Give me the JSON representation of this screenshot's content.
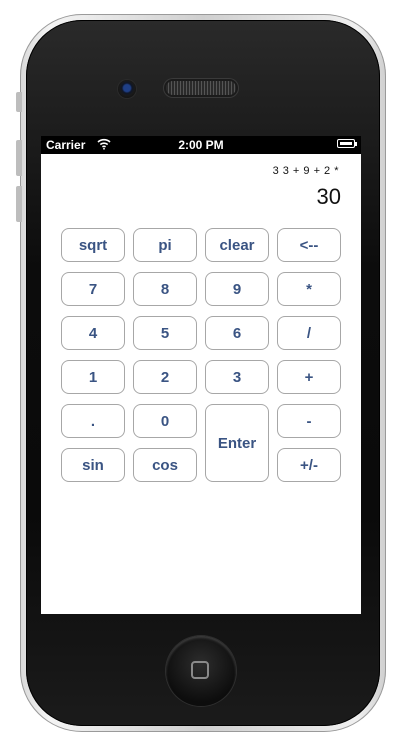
{
  "status_bar": {
    "carrier": "Carrier",
    "time": "2:00 PM"
  },
  "calculator": {
    "history": "3 3 + 9 + 2 *",
    "display": "30",
    "buttons": {
      "sqrt": "sqrt",
      "pi": "pi",
      "clear": "clear",
      "backspace": "<--",
      "seven": "7",
      "eight": "8",
      "nine": "9",
      "multiply": "*",
      "four": "4",
      "five": "5",
      "six": "6",
      "divide": "/",
      "one": "1",
      "two": "2",
      "three": "3",
      "plus": "+",
      "decimal": ".",
      "zero": "0",
      "enter": "Enter",
      "minus": "-",
      "sin": "sin",
      "cos": "cos",
      "sign": "+/-"
    },
    "text_color": "#3a5483"
  },
  "icons": {
    "wifi": "wifi-icon",
    "battery": "battery-icon",
    "home": "home-button-icon"
  }
}
